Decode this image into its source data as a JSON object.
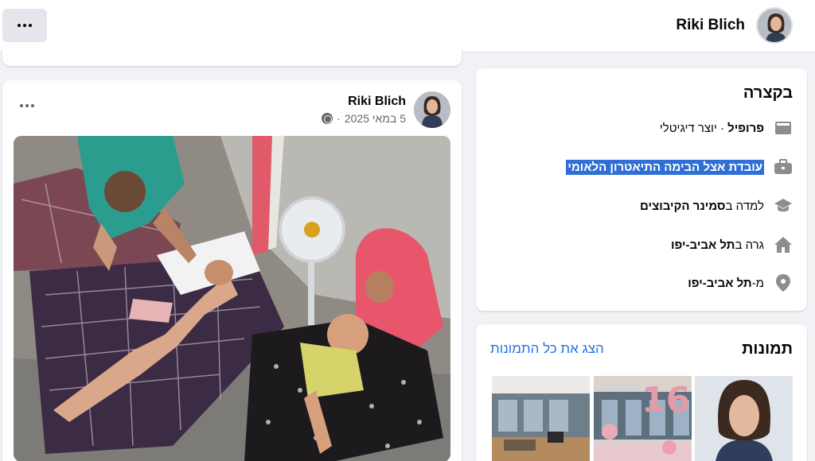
{
  "topbar": {
    "user_name": "Riki Blich",
    "more_icon": "more-horizontal-icon"
  },
  "post": {
    "author": "Riki Blich",
    "date": "5 במאי 2025",
    "separator": "·",
    "privacy_icon": "globe-icon",
    "more_icon": "more-horizontal-icon"
  },
  "intro": {
    "title": "בקצרה",
    "items": [
      {
        "icon": "profile-card-icon",
        "bold": "פרופיל",
        "text": " · יוצר דיגיטלי"
      },
      {
        "icon": "briefcase-icon",
        "text": "עובדת אצל הבימה התיאטרון הלאומי",
        "highlighted": true
      },
      {
        "icon": "graduation-cap-icon",
        "prefix": "למדה ב",
        "bold": "סמינר הקיבוצים"
      },
      {
        "icon": "home-icon",
        "prefix": "גרה ב",
        "bold": "תל אביב-יפו"
      },
      {
        "icon": "location-pin-icon",
        "prefix": "מ-",
        "bold": "תל אביב-יפו"
      }
    ]
  },
  "photos": {
    "title": "תמונות",
    "see_all": "הצג את כל התמונות"
  },
  "colors": {
    "link": "#1b74e4",
    "highlight": "#2f6fd6",
    "background": "#f0f2f5"
  }
}
